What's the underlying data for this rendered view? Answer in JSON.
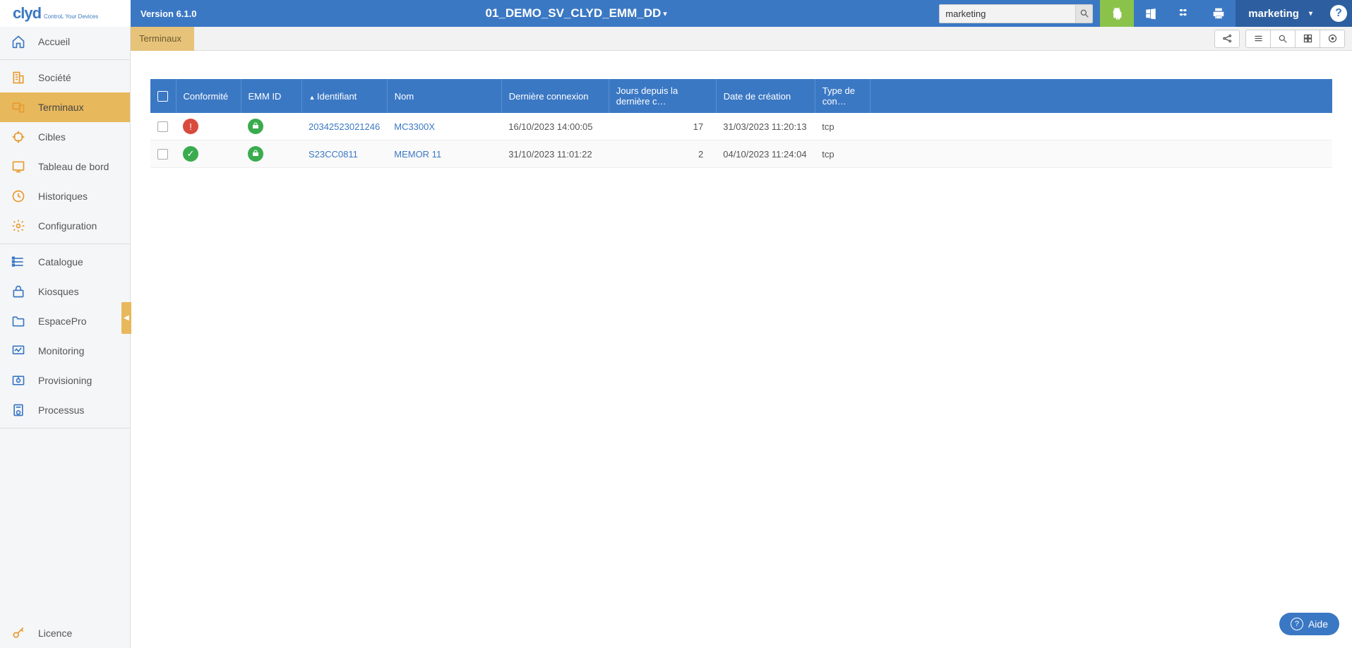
{
  "header": {
    "logo_text": "clyd",
    "logo_sub": "ControL Your Devices",
    "version": "Version 6.1.0",
    "title": "01_DEMO_SV_CLYD_EMM_DD",
    "search_value": "marketing",
    "user": "marketing"
  },
  "sidebar": {
    "home": "Accueil",
    "s1": [
      "Société",
      "Terminaux",
      "Cibles",
      "Tableau de bord",
      "Historiques",
      "Configuration"
    ],
    "s2": [
      "Catalogue",
      "Kiosques",
      "EspacePro",
      "Monitoring",
      "Provisioning",
      "Processus"
    ],
    "licence": "Licence"
  },
  "breadcrumb": "Terminaux",
  "table": {
    "headers": {
      "conformite": "Conformité",
      "emm": "EMM ID",
      "identifiant": "Identifiant",
      "nom": "Nom",
      "derniere": "Dernière connexion",
      "jours": "Jours depuis la dernière c…",
      "date": "Date de création",
      "type": "Type de con…"
    },
    "rows": [
      {
        "conf_status": "error",
        "emm_status": "ok",
        "identifiant": "20342523021246",
        "nom": "MC3300X",
        "derniere": "16/10/2023 14:00:05",
        "jours": "17",
        "date": "31/03/2023 11:20:13",
        "type": "tcp"
      },
      {
        "conf_status": "ok",
        "emm_status": "ok",
        "identifiant": "S23CC0811",
        "nom": "MEMOR 11",
        "derniere": "31/10/2023 11:01:22",
        "jours": "2",
        "date": "04/10/2023 11:24:04",
        "type": "tcp"
      }
    ]
  },
  "aide": "Aide"
}
